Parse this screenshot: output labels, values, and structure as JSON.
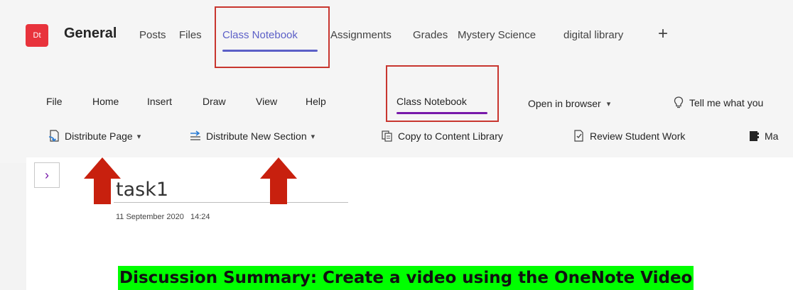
{
  "team": {
    "avatar_initials": "Dt",
    "channel_name": "General",
    "tabs": [
      {
        "label": "Posts"
      },
      {
        "label": "Files"
      },
      {
        "label": "Class Notebook",
        "active": true
      },
      {
        "label": "Assignments"
      },
      {
        "label": "Grades"
      },
      {
        "label": "Mystery Science"
      },
      {
        "label": "digital library"
      }
    ],
    "add_tab_glyph": "+"
  },
  "ribbon": {
    "tabs": [
      {
        "label": "File"
      },
      {
        "label": "Home"
      },
      {
        "label": "Insert"
      },
      {
        "label": "Draw"
      },
      {
        "label": "View"
      },
      {
        "label": "Help"
      },
      {
        "label": "Class Notebook",
        "active": true
      },
      {
        "label": "Open in browser"
      },
      {
        "label": "Tell me what you"
      }
    ],
    "tools": [
      {
        "label": "Distribute Page",
        "icon": "distribute-page-icon"
      },
      {
        "label": "Distribute New Section",
        "icon": "distribute-section-icon"
      },
      {
        "label": "Copy to Content Library",
        "icon": "copy-icon"
      },
      {
        "label": "Review Student Work",
        "icon": "review-icon"
      },
      {
        "label": "Ma",
        "icon": "notebook-icon"
      }
    ]
  },
  "page": {
    "title": "task1",
    "date": "11 September 2020",
    "time": "14:24",
    "summary": "Discussion Summary: Create a video using the OneNote Video"
  },
  "colors": {
    "accent_teams": "#5b5fc7",
    "accent_onenote": "#7719aa",
    "highlight_box": "#c8362f",
    "arrow": "#c8200e",
    "summary_highlight": "#00ff00"
  }
}
